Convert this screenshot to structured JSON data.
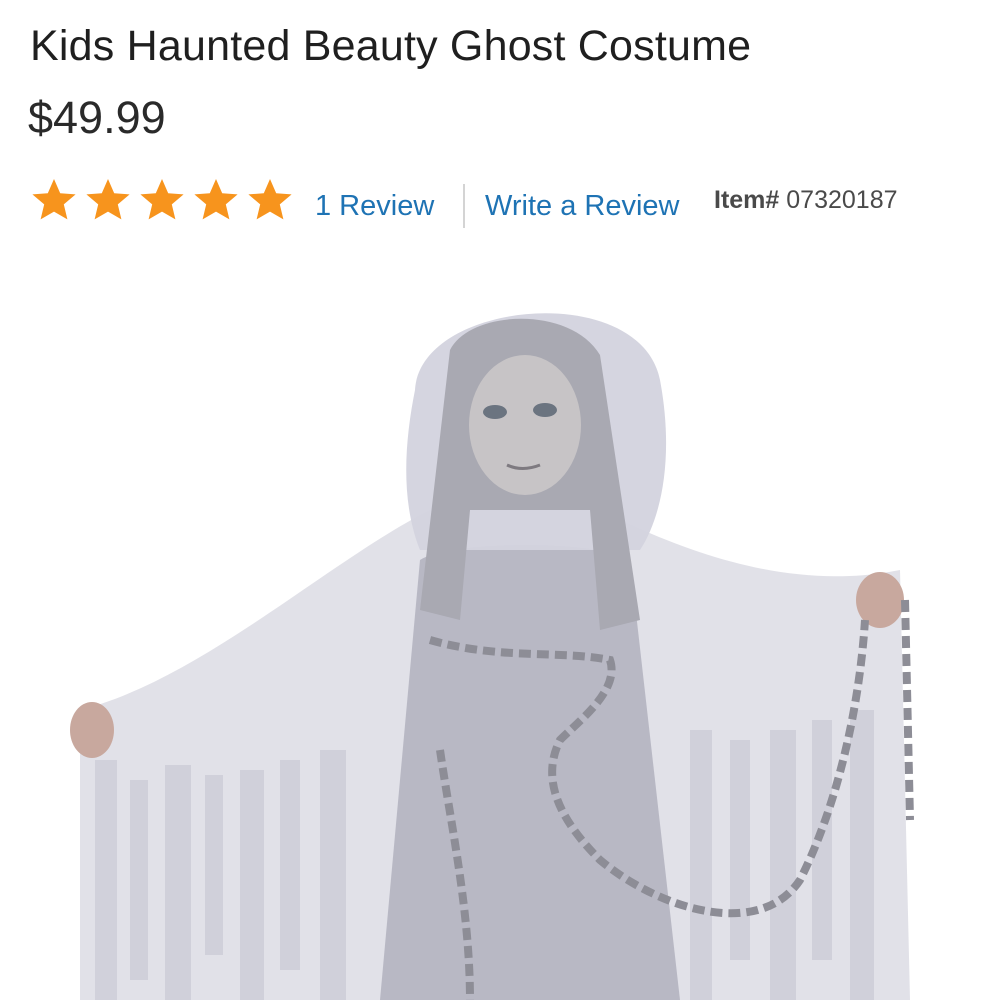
{
  "product": {
    "title": "Kids Haunted Beauty Ghost Costume",
    "price": "$49.99"
  },
  "rating": {
    "stars": 5,
    "max_stars": 5,
    "star_color": "#f7941d",
    "review_count_label": "1 Review",
    "write_review_label": "Write a Review"
  },
  "item": {
    "label": "Item#",
    "number": "07320187"
  },
  "colors": {
    "link": "#1e73b4",
    "text": "#222222"
  },
  "image": {
    "alt": "Child in a gray hooded ghost costume with tattered sheer sleeves, holding a silver chain"
  }
}
